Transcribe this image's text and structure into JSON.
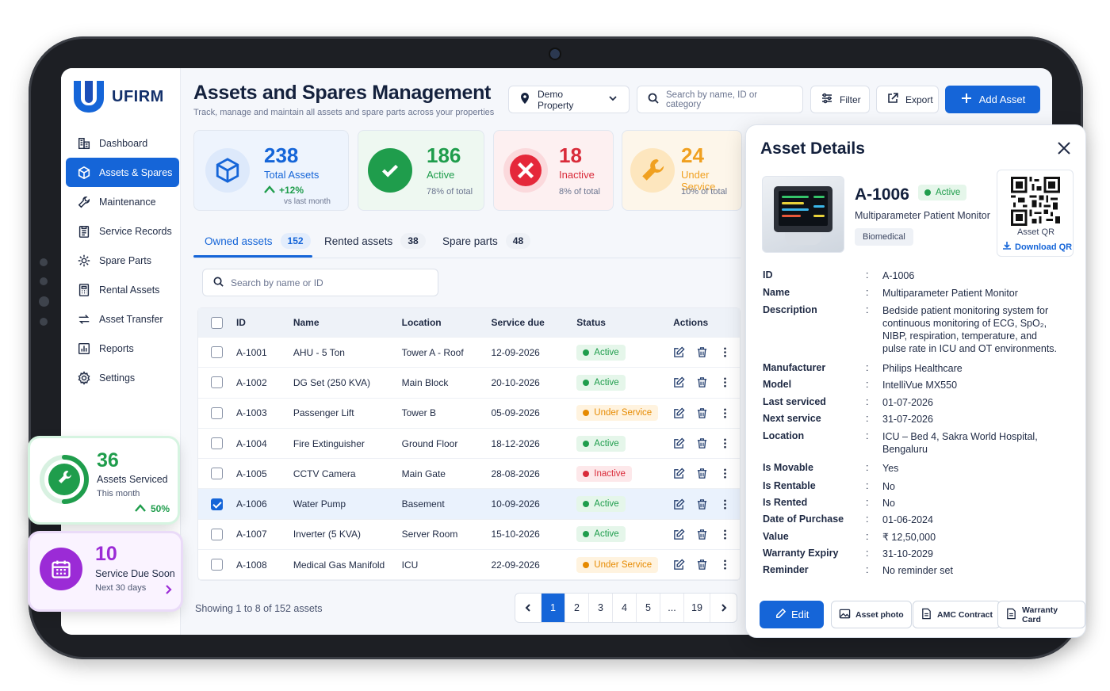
{
  "app": {
    "logo_text": "UFIRM"
  },
  "sidebar": {
    "items": [
      {
        "label": "Dashboard",
        "icon": "building-icon"
      },
      {
        "label": "Assets & Spares",
        "icon": "cube-icon",
        "active": true
      },
      {
        "label": "Maintenance",
        "icon": "wrench-icon"
      },
      {
        "label": "Service Records",
        "icon": "clipboard-icon"
      },
      {
        "label": "Spare Parts",
        "icon": "gear-icon"
      },
      {
        "label": "Rental Assets",
        "icon": "calculator-icon"
      },
      {
        "label": "Asset Transfer",
        "icon": "transfer-icon"
      },
      {
        "label": "Reports",
        "icon": "bar-chart-icon"
      },
      {
        "label": "Settings",
        "icon": "settings-icon"
      }
    ]
  },
  "header": {
    "title": "Assets and Spares Management",
    "subtitle": "Track, manage and maintain all assets and spare parts across your properties",
    "property": "Demo Property",
    "search_placeholder": "Search by name, ID or category",
    "filter": "Filter",
    "export": "Export",
    "add": "Add Asset"
  },
  "stats": [
    {
      "num": "238",
      "label": "Total Assets",
      "trend": "+12%",
      "sub": "vs last month",
      "color": "#1565d8"
    },
    {
      "num": "186",
      "label": "Active",
      "sub": "78% of total",
      "color": "#1f9d4c"
    },
    {
      "num": "18",
      "label": "Inactive",
      "sub": "8% of total",
      "color": "#d92b3a"
    },
    {
      "num": "24",
      "label": "Under Service",
      "sub": "10% of total",
      "color": "#f0a020"
    }
  ],
  "tabs": [
    {
      "label": "Owned assets",
      "count": "152"
    },
    {
      "label": "Rented assets",
      "count": "38"
    },
    {
      "label": "Spare parts",
      "count": "48"
    }
  ],
  "table_search_placeholder": "Search by name or ID",
  "table": {
    "columns": [
      "ID",
      "Name",
      "Location",
      "Service due",
      "Status",
      "Actions"
    ],
    "rows": [
      {
        "id": "A-1001",
        "name": "AHU - 5 Ton",
        "location": "Tower A - Roof",
        "due": "12-09-2026",
        "status": "Active"
      },
      {
        "id": "A-1002",
        "name": "DG Set (250 KVA)",
        "location": "Main Block",
        "due": "20-10-2026",
        "status": "Active"
      },
      {
        "id": "A-1003",
        "name": "Passenger Lift",
        "location": "Tower B",
        "due": "05-09-2026",
        "status": "Under Service"
      },
      {
        "id": "A-1004",
        "name": "Fire Extinguisher",
        "location": "Ground Floor",
        "due": "18-12-2026",
        "status": "Active"
      },
      {
        "id": "A-1005",
        "name": "CCTV Camera",
        "location": "Main Gate",
        "due": "28-08-2026",
        "status": "Inactive"
      },
      {
        "id": "A-1006",
        "name": "Water Pump",
        "location": "Basement",
        "due": "10-09-2026",
        "status": "Active"
      },
      {
        "id": "A-1007",
        "name": "Inverter (5 KVA)",
        "location": "Server Room",
        "due": "15-10-2026",
        "status": "Active"
      },
      {
        "id": "A-1008",
        "name": "Medical Gas Manifold",
        "location": "ICU",
        "due": "22-09-2026",
        "status": "Under Service"
      }
    ]
  },
  "pagination": {
    "showing": "Showing 1 to 8 of 152 assets",
    "pages": [
      "1",
      "2",
      "3",
      "4",
      "5",
      "...",
      "19"
    ]
  },
  "float_serviced": {
    "num": "36",
    "label": "Assets Serviced",
    "sub": "This month",
    "trend": "50%",
    "progress": 0.5
  },
  "float_due": {
    "num": "10",
    "label": "Service Due Soon",
    "sub": "Next 30 days"
  },
  "details": {
    "title": "Asset Details",
    "asset_id": "A-1006",
    "status": "Active",
    "name": "Multiparameter Patient Monitor",
    "category": "Biomedical",
    "qr_label": "Asset QR",
    "qr_download": "Download QR",
    "fields": [
      {
        "k": "ID",
        "v": "A-1006"
      },
      {
        "k": "Name",
        "v": "Multiparameter Patient Monitor"
      },
      {
        "k": "Description",
        "v": "Bedside patient monitoring system for continuous monitoring of ECG, SpO₂, NIBP, respiration, temperature, and pulse rate in ICU and OT environments."
      },
      {
        "k": "Manufacturer",
        "v": "Philips Healthcare"
      },
      {
        "k": "Model",
        "v": "IntelliVue MX550"
      },
      {
        "k": "Last serviced",
        "v": "01-07-2026"
      },
      {
        "k": "Next service",
        "v": "31-07-2026"
      },
      {
        "k": "Location",
        "v": "ICU – Bed 4, Sakra World Hospital, Bengaluru"
      },
      {
        "k": "Is Movable",
        "v": "Yes"
      },
      {
        "k": "Is Rentable",
        "v": "No"
      },
      {
        "k": "Is Rented",
        "v": "No"
      },
      {
        "k": "Date of Purchase",
        "v": "01-06-2024"
      },
      {
        "k": "Value",
        "v": "₹ 12,50,000"
      },
      {
        "k": "Warranty Expiry",
        "v": "31-10-2029"
      },
      {
        "k": "Reminder",
        "v": "No reminder set"
      }
    ],
    "buttons": [
      "Edit",
      "Asset photo",
      "AMC Contract",
      "Warranty Card"
    ]
  }
}
